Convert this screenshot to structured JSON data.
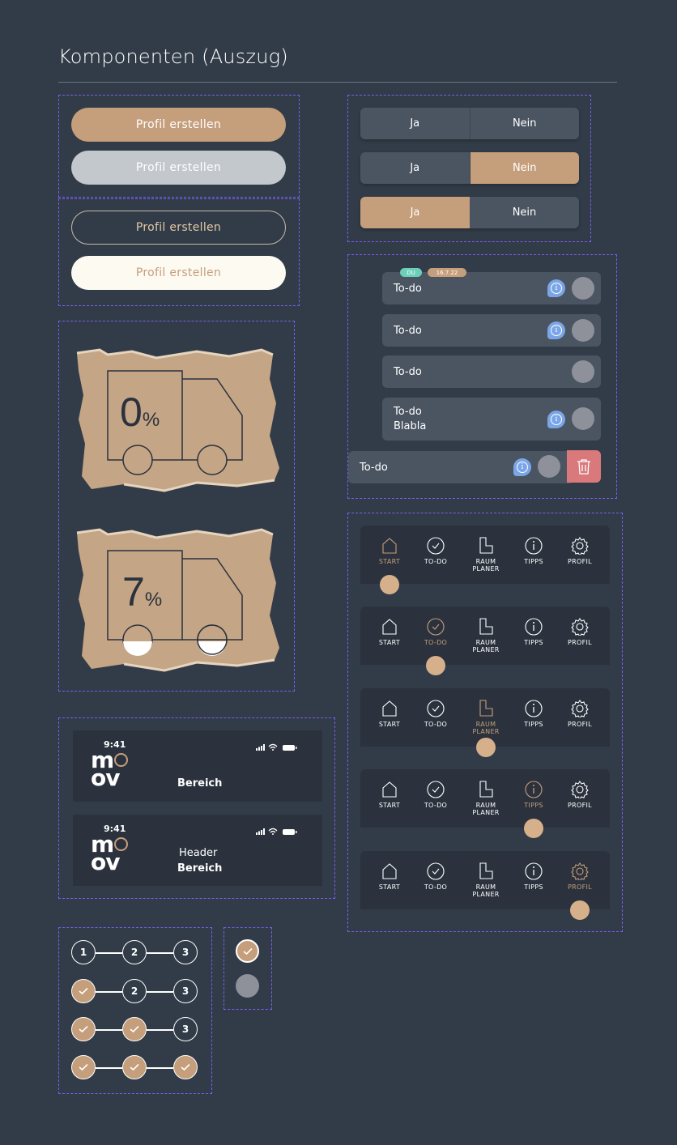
{
  "page": {
    "title": "Komponenten (Auszug)"
  },
  "buttons": {
    "primary_label": "Profil erstellen",
    "disabled_label": "Profil erstellen",
    "outline_label": "Profil erstellen",
    "light_label": "Profil erstellen"
  },
  "toggles": {
    "yes": "Ja",
    "no": "Nein",
    "rows": [
      {
        "yes": "Ja",
        "no": "Nein",
        "active": "none"
      },
      {
        "yes": "Ja",
        "no": "Nein",
        "active": "no"
      },
      {
        "yes": "Ja",
        "no": "Nein",
        "active": "yes"
      }
    ]
  },
  "todos": {
    "badge_user": "DU",
    "badge_date": "16.7.22",
    "items": [
      {
        "label": "To-do"
      },
      {
        "label": "To-do"
      },
      {
        "label": "To-do"
      },
      {
        "label_line1": "To-do",
        "label_line2": "Blabla"
      },
      {
        "label": "To-do"
      }
    ]
  },
  "progress": {
    "cards": [
      {
        "value": "0",
        "unit": "%",
        "fraction": 0
      },
      {
        "value": "7",
        "unit": "%",
        "fraction": 0.07
      }
    ]
  },
  "nav": {
    "items": [
      {
        "icon": "home-icon",
        "label": "START"
      },
      {
        "icon": "check-circle-icon",
        "label": "TO-DO"
      },
      {
        "icon": "floor-plan-icon",
        "label_line1": "RAUM",
        "label_line2": "PLANER"
      },
      {
        "icon": "info-icon",
        "label": "TIPPS"
      },
      {
        "icon": "gear-icon",
        "label": "PROFIL"
      }
    ],
    "active_states": [
      "START",
      "TO-DO",
      "RAUM PLANER",
      "TIPPS",
      "PROFIL"
    ],
    "colors": {
      "active": "#c59e7b",
      "indicator": "#d6b08b"
    }
  },
  "headers": [
    {
      "time": "9:41",
      "logo_top": "m",
      "logo_bottom": "ov",
      "line1": "",
      "line2": "Bereich"
    },
    {
      "time": "9:41",
      "logo_top": "m",
      "logo_bottom": "ov",
      "line1": "Header",
      "line2": "Bereich"
    }
  ],
  "stepper": {
    "rows": [
      [
        "1",
        "2",
        "3"
      ],
      [
        "done",
        "2",
        "3"
      ],
      [
        "done",
        "done",
        "3"
      ],
      [
        "done",
        "done",
        "done"
      ]
    ]
  },
  "colors": {
    "background": "#323c48",
    "accent": "#c59e7b",
    "surface": "#4b5562",
    "info": "#7aa6e8",
    "danger": "#d9797b",
    "badge_user": "#6ccfb8"
  }
}
